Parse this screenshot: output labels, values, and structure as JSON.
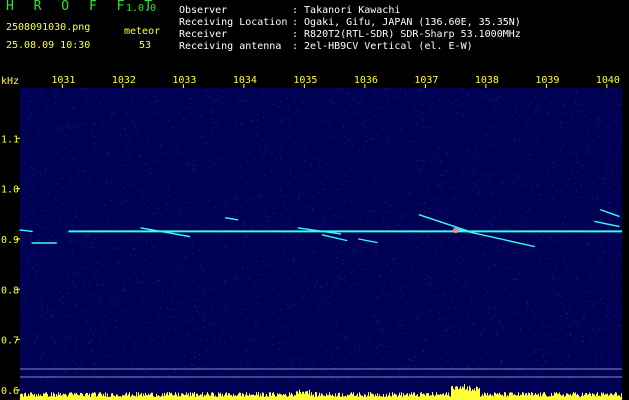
{
  "app": {
    "title": "H R O F F T",
    "version": "1.0.0"
  },
  "file": {
    "name": "2508091030.png",
    "datetime": "25.08.09 10:30"
  },
  "meteor": {
    "label": "meteor",
    "count": "53"
  },
  "info": [
    {
      "label": "Observer",
      "value": ": Takanori Kawachi"
    },
    {
      "label": "Receiving Location",
      "value": ": Ogaki, Gifu, JAPAN (136.60E, 35.35N)"
    },
    {
      "label": "Receiver",
      "value": ": R820T2(RTL-SDR) SDR-Sharp 53.1000MHz"
    },
    {
      "label": "Receiving antenna",
      "value": ": 2el-HB9CV Vertical (el. E-W)"
    }
  ],
  "colors": {
    "background": "#000000",
    "plot": "#000055",
    "signal": "#33ffee",
    "tick_label": "#ffff33",
    "header_label": "#ffffff",
    "title": "#2ee52e"
  },
  "chart_data": {
    "type": "heatmap",
    "xlabel": "",
    "ylabel": "kHz",
    "x_ticks": [
      "1031",
      "1032",
      "1033",
      "1034",
      "1035",
      "1036",
      "1037",
      "1038",
      "1039",
      "1040"
    ],
    "y_ticks": [
      "1.1",
      "1.0",
      "0.9",
      "0.8",
      "0.7",
      "0.6"
    ],
    "xlim": [
      1030.3,
      1040.25
    ],
    "ylim": [
      0.58,
      1.2
    ],
    "carrier_khz": 0.915,
    "echoes": [
      {
        "t0": 1030.3,
        "t1": 1030.5,
        "f0": 0.918,
        "f1": 0.915
      },
      {
        "t0": 1030.5,
        "t1": 1030.9,
        "f0": 0.892,
        "f1": 0.892
      },
      {
        "t0": 1032.3,
        "t1": 1033.1,
        "f0": 0.922,
        "f1": 0.905
      },
      {
        "t0": 1033.7,
        "t1": 1033.9,
        "f0": 0.942,
        "f1": 0.938
      },
      {
        "t0": 1034.9,
        "t1": 1035.6,
        "f0": 0.922,
        "f1": 0.91
      },
      {
        "t0": 1035.3,
        "t1": 1035.7,
        "f0": 0.908,
        "f1": 0.897
      },
      {
        "t0": 1035.9,
        "t1": 1036.2,
        "f0": 0.9,
        "f1": 0.893
      },
      {
        "t0": 1036.9,
        "t1": 1037.8,
        "f0": 0.948,
        "f1": 0.912
      },
      {
        "t0": 1037.5,
        "t1": 1038.8,
        "f0": 0.92,
        "f1": 0.885
      },
      {
        "t0": 1039.8,
        "t1": 1040.2,
        "f0": 0.935,
        "f1": 0.925
      },
      {
        "t0": 1039.9,
        "t1": 1040.2,
        "f0": 0.958,
        "f1": 0.945
      }
    ]
  }
}
